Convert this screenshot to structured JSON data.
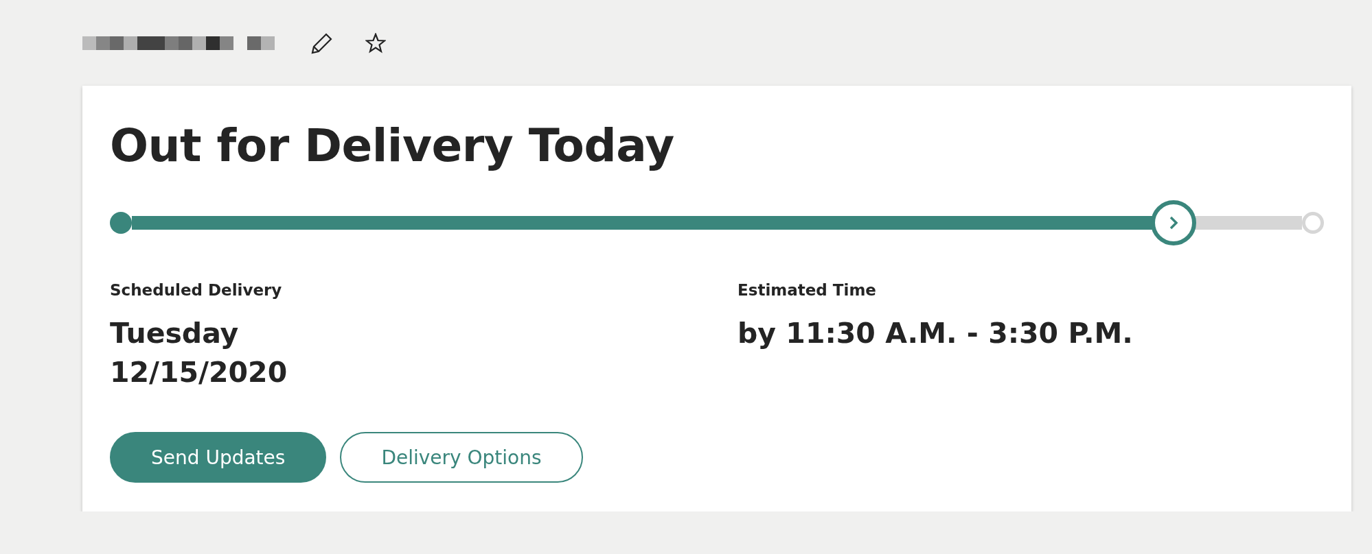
{
  "header": {
    "favorite": false
  },
  "card": {
    "title": "Out for Delivery Today",
    "progress": {
      "level": 0.89
    },
    "details": [
      {
        "label": "Scheduled Delivery",
        "lines": [
          "Tuesday",
          "12/15/2020"
        ]
      },
      {
        "label": "Estimated Time",
        "lines": [
          "by 11:30 A.M. - 3:30 P.M."
        ]
      }
    ],
    "buttons": [
      {
        "label": "Send Updates",
        "kind": "primary"
      },
      {
        "label": "Delivery Options",
        "kind": "secondary"
      }
    ]
  }
}
